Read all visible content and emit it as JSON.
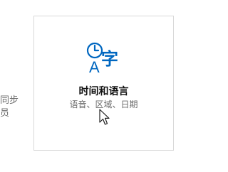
{
  "left_fragment": {
    "line1": "同步",
    "line2": "员"
  },
  "tile": {
    "icon": "time-language-icon",
    "icon_letter": "A",
    "icon_char": "字",
    "title": "时间和语言",
    "subtitle": "语音、区域、日期"
  },
  "colors": {
    "accent": "#0067c0",
    "border": "#d9d9d9",
    "secondary_text": "#6a6a6a"
  }
}
